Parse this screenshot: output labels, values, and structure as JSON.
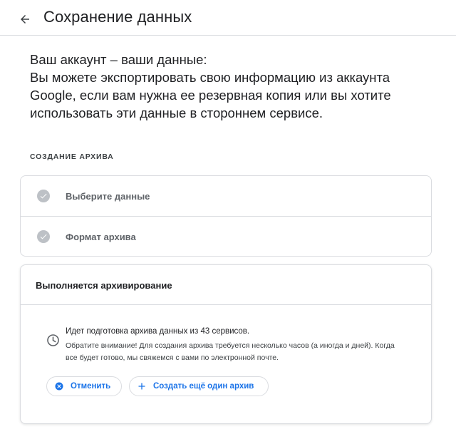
{
  "header": {
    "back_icon": "arrow-back-icon",
    "title": "Сохранение данных"
  },
  "intro": {
    "line1": "Ваш аккаунт – ваши данные:",
    "line2": "Вы можете экспортировать свою информацию из аккаунта Google, если вам нужна ее резервная копия или вы хотите использовать эти данные в стороннем сервисе."
  },
  "section_label": "СОЗДАНИЕ АРХИВА",
  "steps": [
    {
      "label": "Выберите данные",
      "icon": "check-circle-icon",
      "status": "done"
    },
    {
      "label": "Формат архива",
      "icon": "check-circle-icon",
      "status": "done"
    }
  ],
  "progress": {
    "title": "Выполняется архивирование",
    "icon": "clock-icon",
    "status_text": "Идет подготовка архива данных из 43 сервисов.",
    "note": "Обратите внимание! Для создания архива требуется несколько часов (а иногда и дней). Когда все будет готово, мы свяжемся с вами по электронной почте.",
    "cancel_label": "Отменить",
    "cancel_icon": "cancel-icon",
    "new_archive_label": "Создать ещё один архив",
    "new_archive_icon": "plus-icon"
  },
  "colors": {
    "accent": "#1a73e8",
    "check_gray": "#bdc1c6",
    "border": "#dadce0",
    "text": "#202124"
  }
}
